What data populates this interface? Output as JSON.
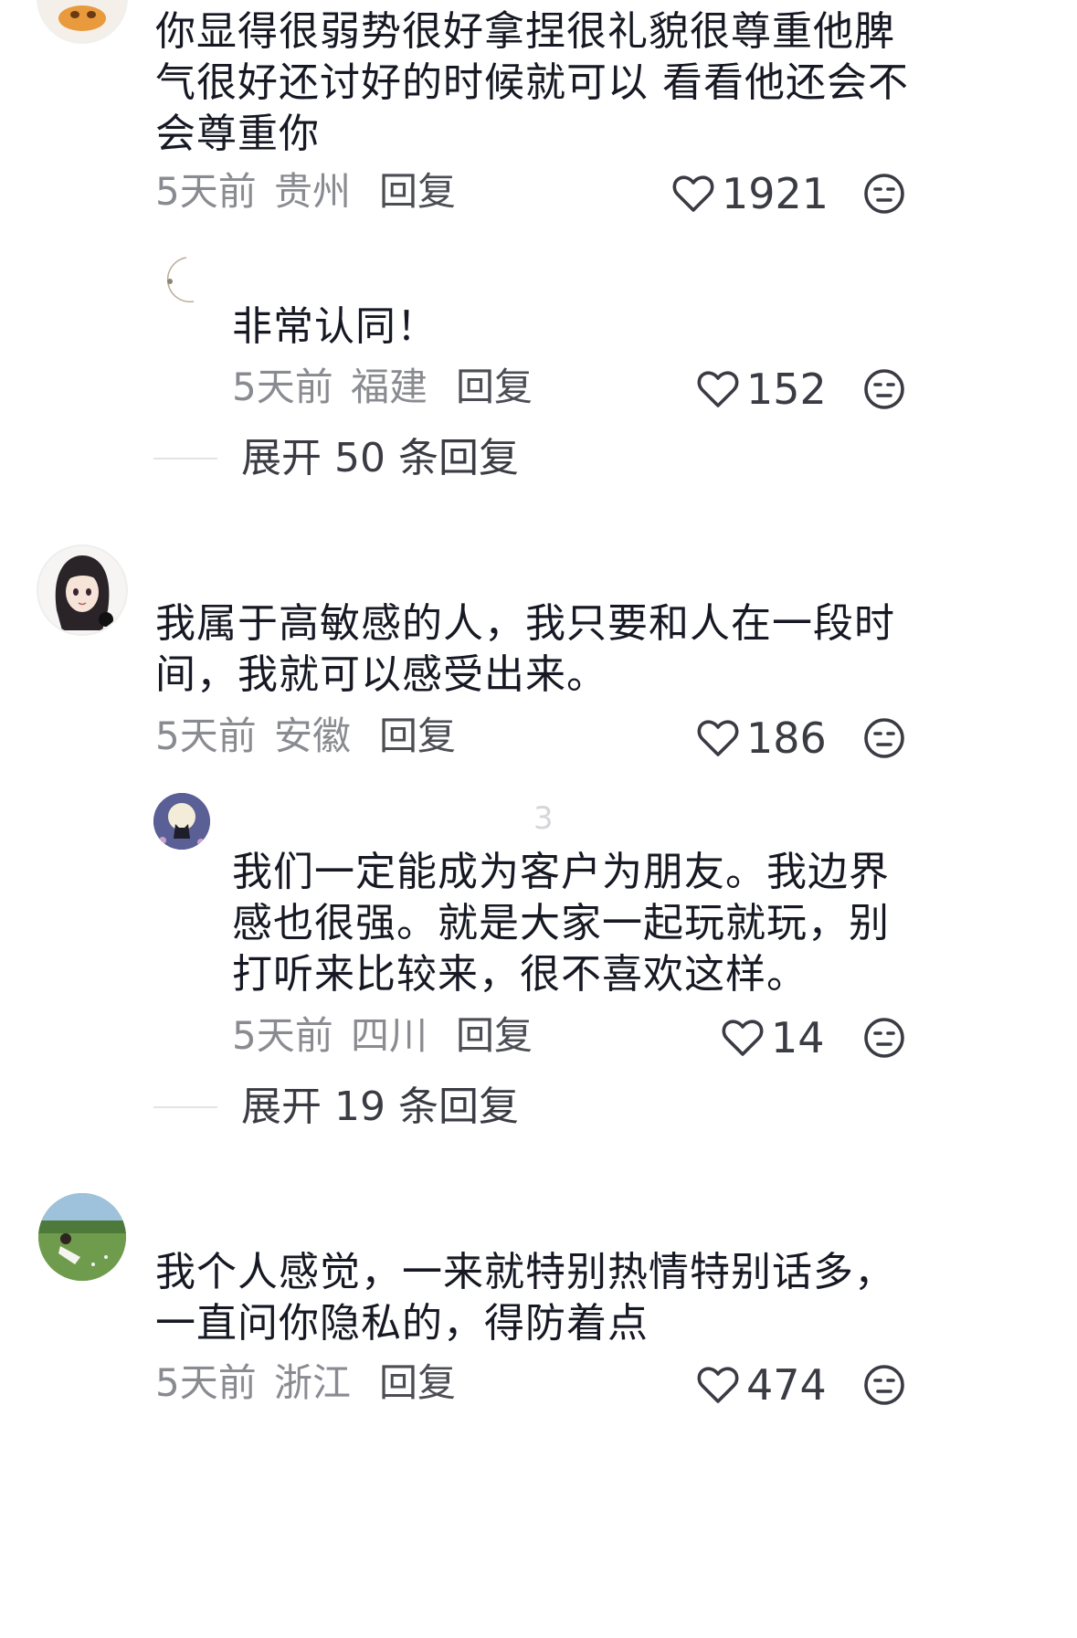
{
  "comments": [
    {
      "avatar": "orange-cartoon-avatar",
      "lines": [
        "你显得很弱势很好拿捏很礼貌很尊重他脾",
        "气很好还讨好的时候就可以 看看他还会不",
        "会尊重你"
      ],
      "time": "5天前",
      "location": "贵州",
      "reply_label": "回复",
      "likes": "1921",
      "replies": [
        {
          "avatar": "moon-avatar",
          "lines": [
            "非常认同！"
          ],
          "time": "5天前",
          "location": "福建",
          "reply_label": "回复",
          "likes": "152"
        }
      ],
      "expand_label": "展开 50 条回复"
    },
    {
      "avatar": "anime-girl-avatar",
      "lines": [
        "我属于高敏感的人，我只要和人在一段时",
        "间，我就可以感受出来。"
      ],
      "time": "5天前",
      "location": "安徽",
      "reply_label": "回复",
      "likes": "186",
      "replies": [
        {
          "avatar": "cat-moon-avatar",
          "name": "3",
          "lines": [
            "我们一定能成为客户为朋友。我边界",
            "感也很强。就是大家一起玩就玩，别",
            "打听来比较来，很不喜欢这样。"
          ],
          "time": "5天前",
          "location": "四川",
          "reply_label": "回复",
          "likes": "14"
        }
      ],
      "expand_label": "展开 19 条回复"
    },
    {
      "avatar": "girl-in-field-avatar",
      "lines": [
        "我个人感觉，一来就特别热情特别话多，",
        "一直问你隐私的，得防着点"
      ],
      "time": "5天前",
      "location": "浙江",
      "reply_label": "回复",
      "likes": "474"
    }
  ],
  "colors": {
    "text": "#161823",
    "meta": "#8a8b91",
    "reply": "#4c4d55"
  }
}
